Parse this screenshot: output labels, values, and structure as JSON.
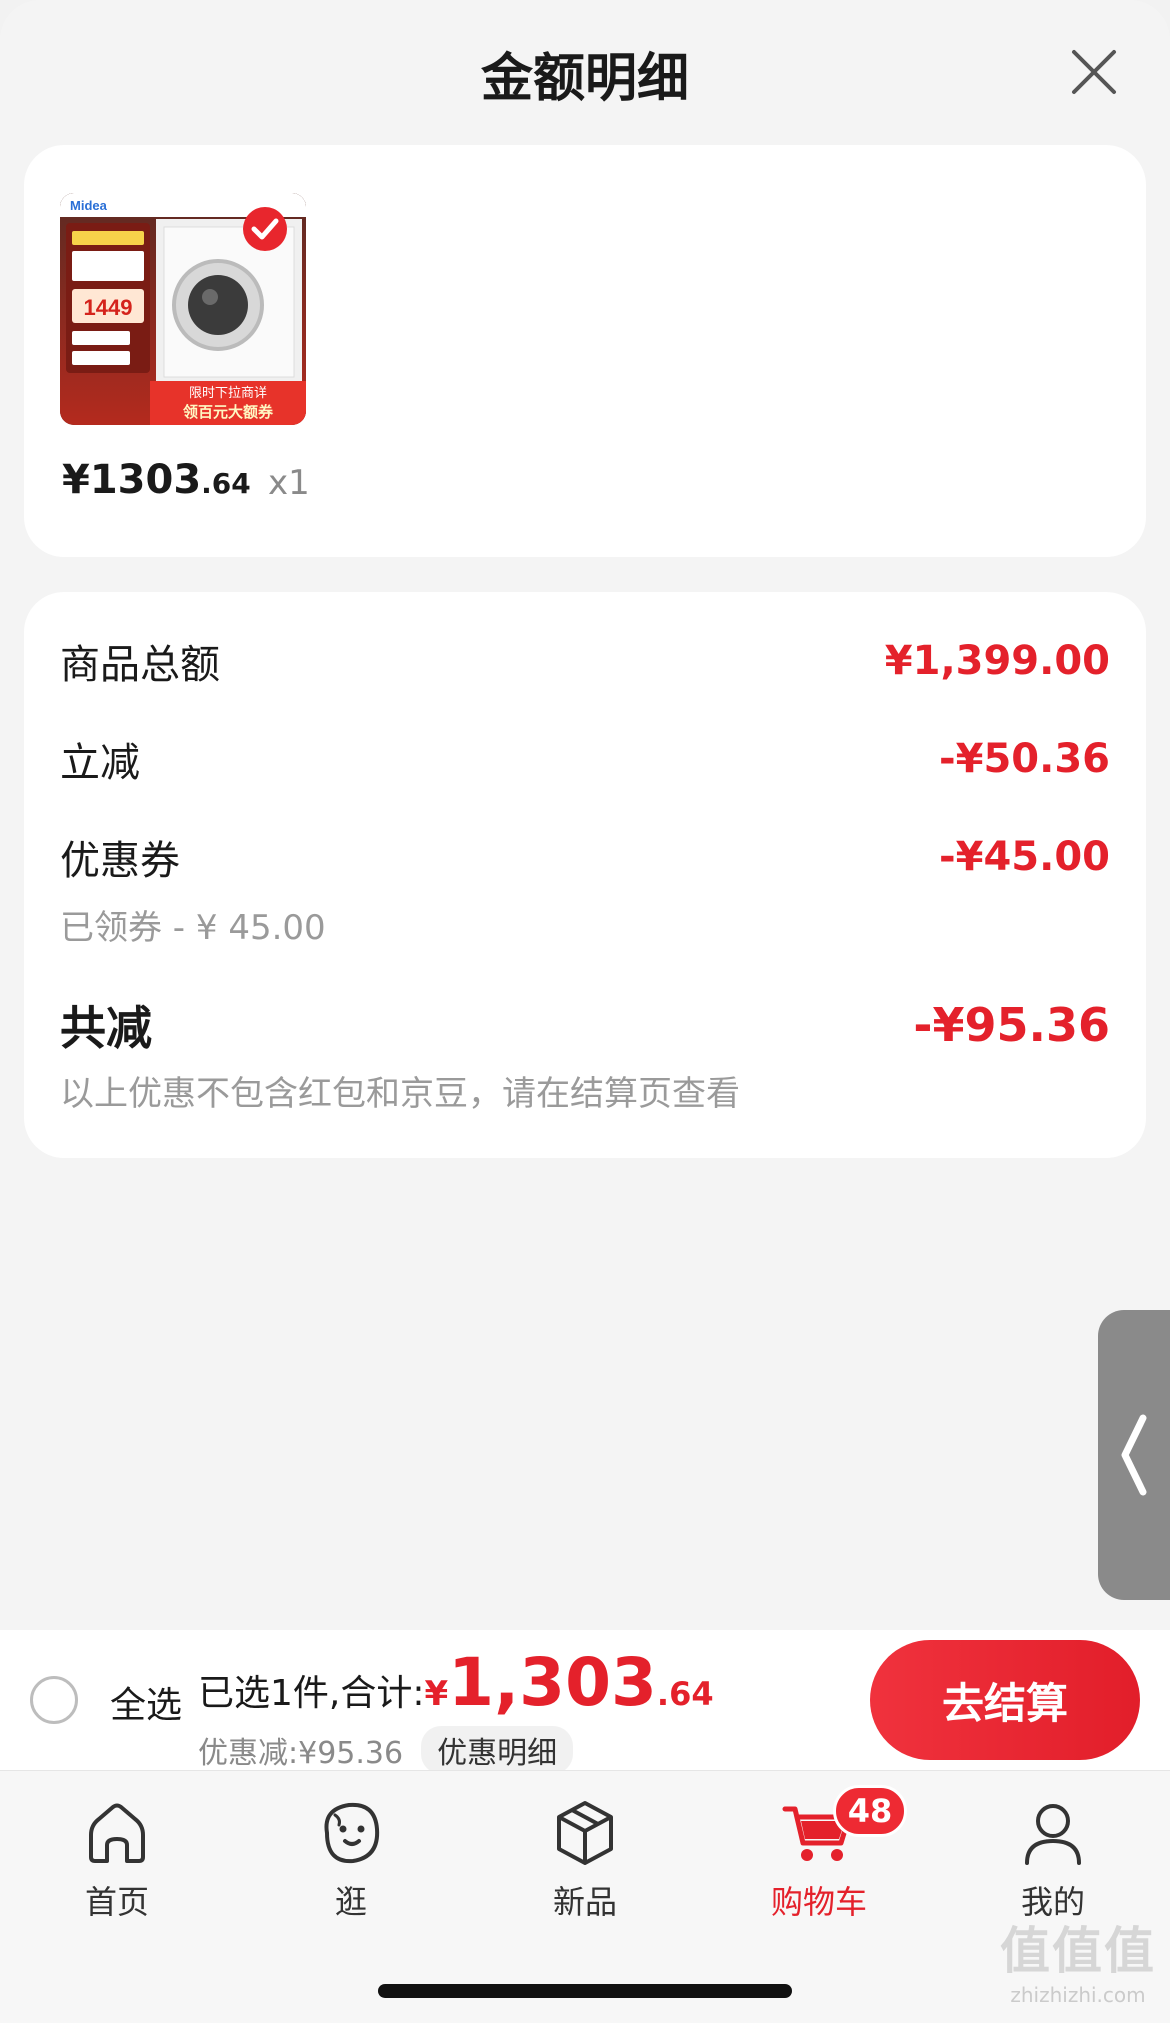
{
  "header": {
    "title": "金额明细"
  },
  "product": {
    "price_main": "¥1303",
    "price_decimal": ".64",
    "quantity": "x1",
    "image_texts": {
      "brand": "Midea",
      "promo_price": "1449",
      "banner": "限时下拉商详",
      "coupon": "领百元大额券"
    }
  },
  "details": {
    "rows": [
      {
        "label": "商品总额",
        "value": "¥1,399.00"
      },
      {
        "label": "立减",
        "value": "-¥50.36"
      },
      {
        "label": "优惠券",
        "value": "-¥45.00",
        "sub": "已领券 - ¥ 45.00"
      }
    ],
    "total": {
      "label": "共减",
      "value": "-¥95.36",
      "note": "以上优惠不包含红包和京豆，请在结算页查看"
    }
  },
  "checkout": {
    "select_all": "全选",
    "selected_text": "已选1件,合计:",
    "currency": "¥",
    "amount_main": "1,303",
    "amount_decimal": ".64",
    "discount_text": "优惠减:¥95.36",
    "detail_link": "优惠明细",
    "button": "去结算"
  },
  "tabbar": {
    "items": [
      {
        "label": "首页",
        "icon": "home-icon"
      },
      {
        "label": "逛",
        "icon": "face-icon"
      },
      {
        "label": "新品",
        "icon": "box-icon"
      },
      {
        "label": "购物车",
        "icon": "cart-icon",
        "badge": "48",
        "active": true
      },
      {
        "label": "我的",
        "icon": "user-icon"
      }
    ]
  },
  "watermark": {
    "main": "值值值",
    "sub": "zhizhizhi.com"
  },
  "colors": {
    "accent": "#e4212b",
    "background": "#f4f4f4",
    "card": "#ffffff"
  }
}
